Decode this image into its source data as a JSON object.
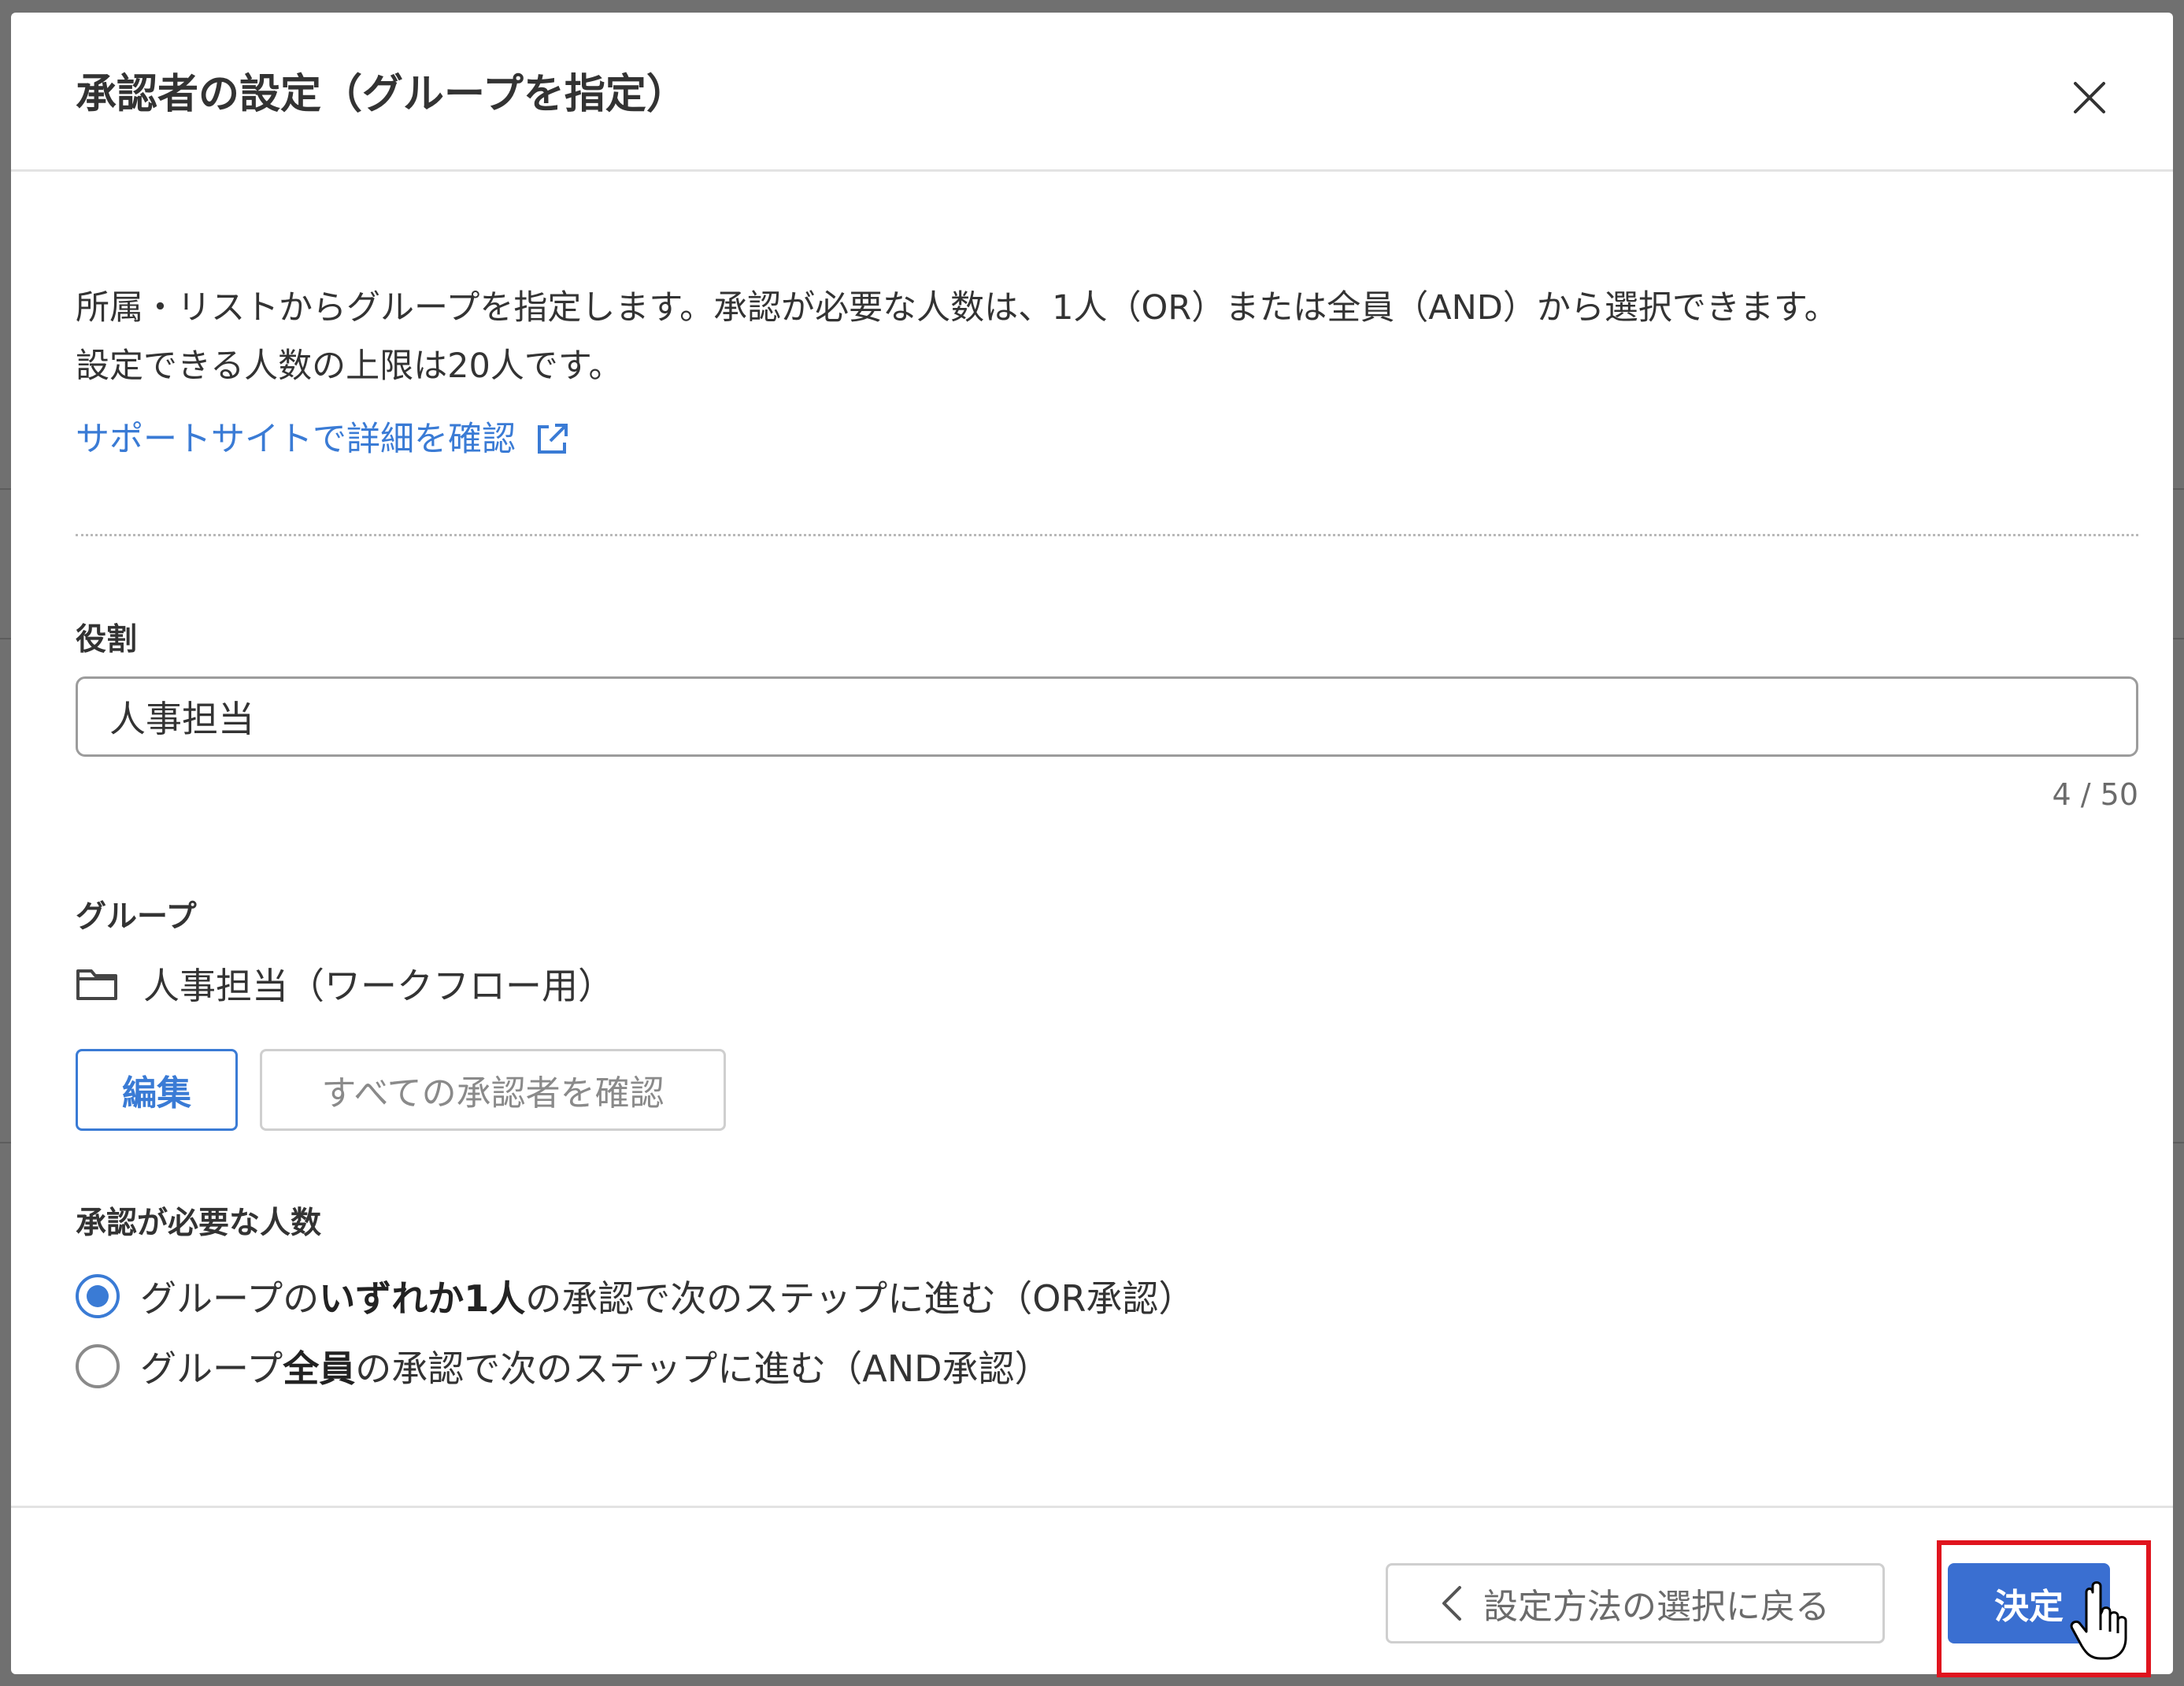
{
  "dialog": {
    "title": "承認者の設定（グループを指定）",
    "description_line1": "所属・リストからグループを指定します。承認が必要な人数は、1人（OR）または全員（AND）から選択できます。",
    "description_line2": "設定できる人数の上限は20人です。",
    "support_link": "サポートサイトで詳細を確認"
  },
  "role": {
    "label": "役割",
    "value": "人事担当",
    "counter": "4 / 50"
  },
  "group": {
    "label": "グループ",
    "name": "人事担当（ワークフロー用）",
    "edit_button": "編集",
    "confirm_all_button": "すべての承認者を確認"
  },
  "approval": {
    "label": "承認が必要な人数",
    "options": [
      {
        "pre": "グループの",
        "bold": "いずれか1人",
        "post": "の承認で次のステップに進む（OR承認）",
        "selected": true
      },
      {
        "pre": "グループ",
        "bold": "全員",
        "post": "の承認で次のステップに進む（AND承認）",
        "selected": false
      }
    ]
  },
  "footer": {
    "back_button": "設定方法の選択に戻る",
    "decide_button": "決定"
  },
  "icons": {
    "close": "close-icon",
    "external_link": "external-link-icon",
    "folder": "folder-icon",
    "back": "chevron-left-icon",
    "cursor": "hand-pointer-icon"
  },
  "colors": {
    "accent": "#3a7bd5",
    "primary_button": "#3a6fd1",
    "highlight": "#e0141e"
  }
}
